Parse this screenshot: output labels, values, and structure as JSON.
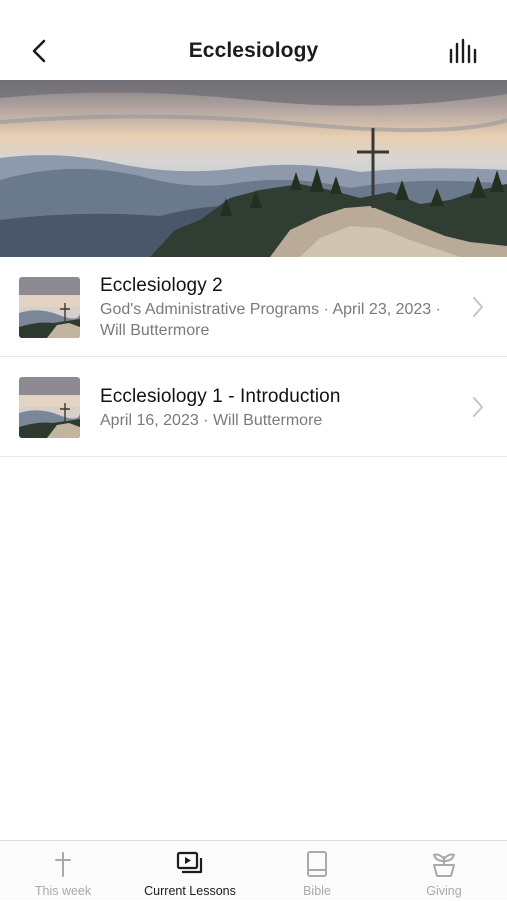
{
  "header": {
    "title": "Ecclesiology",
    "back_icon": "chevron-left-icon",
    "levels_icon": "equalizer-bars-icon"
  },
  "hero": {
    "image": "mountain-cross-landscape"
  },
  "lessons": [
    {
      "title": "Ecclesiology 2",
      "meta": "God's Administrative Programs · April 23, 2023 · Will Buttermore"
    },
    {
      "title": "Ecclesiology 1 - Introduction",
      "meta": "April 16, 2023 · Will Buttermore"
    }
  ],
  "tabs": [
    {
      "label": "This week",
      "icon": "cross-icon",
      "active": false
    },
    {
      "label": "Current Lessons",
      "icon": "video-library-icon",
      "active": true
    },
    {
      "label": "Bible",
      "icon": "book-icon",
      "active": false
    },
    {
      "label": "Giving",
      "icon": "plant-pot-icon",
      "active": false
    }
  ],
  "colors": {
    "active_tab": "#1c1c1e",
    "inactive_tab": "#a9a9a9",
    "meta_text": "#7a7a7a"
  }
}
